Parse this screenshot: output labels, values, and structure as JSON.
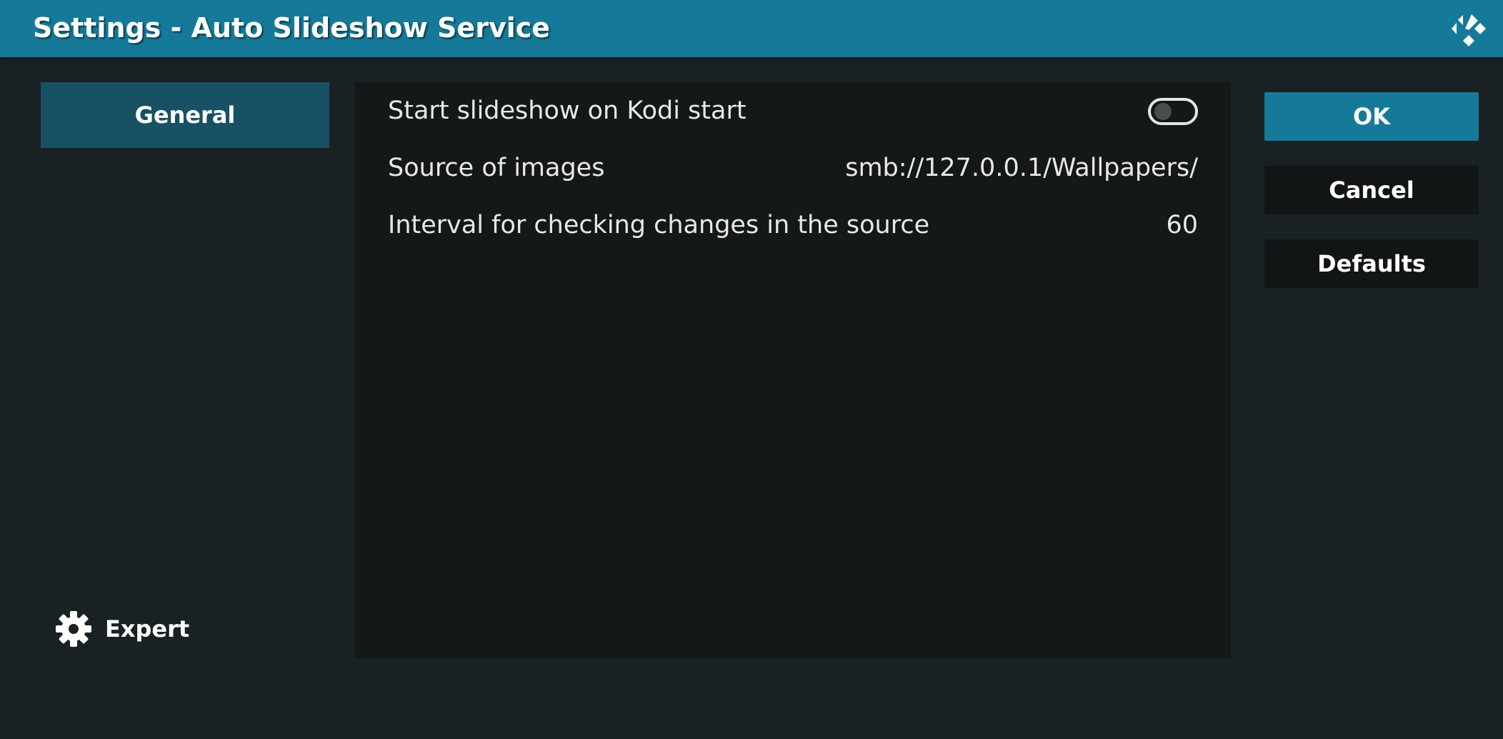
{
  "window": {
    "title": "Settings - Auto Slideshow Service"
  },
  "sidebar": {
    "categories": [
      {
        "label": "General",
        "selected": true
      }
    ],
    "level_label": "Expert"
  },
  "settings": [
    {
      "label": "Start slideshow on Kodi start",
      "type": "toggle",
      "enabled": false
    },
    {
      "label": "Source of images",
      "type": "value",
      "value": "smb://127.0.0.1/Wallpapers/"
    },
    {
      "label": "Interval for checking changes in the source",
      "type": "value",
      "value": "60"
    }
  ],
  "buttons": {
    "ok": "OK",
    "cancel": "Cancel",
    "defaults": "Defaults"
  },
  "colors": {
    "accent": "#157a99",
    "background": "#1a2124",
    "panel": "#141819",
    "selected_category": "#175163"
  },
  "icons": {
    "logo": "kodi-logo-icon",
    "level": "gear-icon"
  }
}
